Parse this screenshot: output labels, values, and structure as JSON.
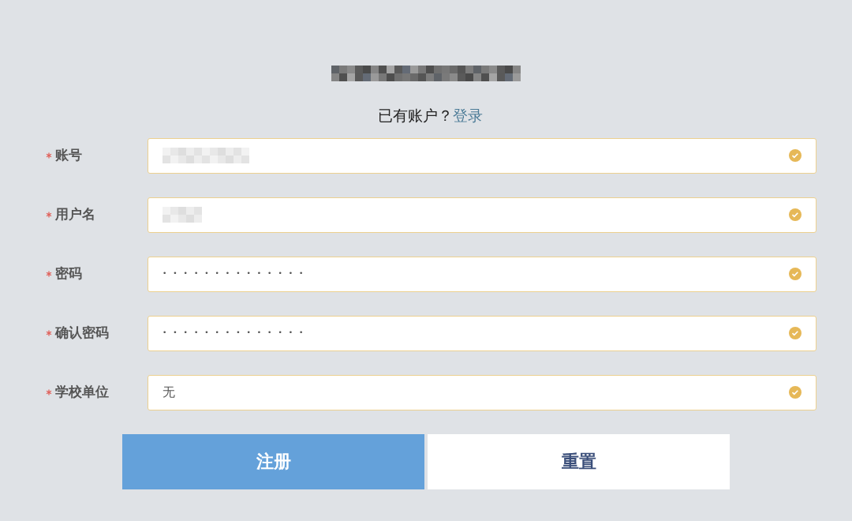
{
  "login_prompt": {
    "text": "已有账户？",
    "link": "登录"
  },
  "fields": [
    {
      "label": "账号",
      "required": true,
      "valid": true,
      "kind": "redacted"
    },
    {
      "label": "用户名",
      "required": true,
      "valid": true,
      "kind": "redacted"
    },
    {
      "label": "密码",
      "required": true,
      "valid": true,
      "kind": "password",
      "value": "••••••••••••••"
    },
    {
      "label": "确认密码",
      "required": true,
      "valid": true,
      "kind": "password",
      "value": "••••••••••••••"
    },
    {
      "label": "学校单位",
      "required": true,
      "valid": true,
      "kind": "text",
      "value": "无"
    }
  ],
  "buttons": [
    {
      "label": "注册",
      "kind": "primary"
    },
    {
      "label": "重置",
      "kind": "secondary"
    }
  ]
}
